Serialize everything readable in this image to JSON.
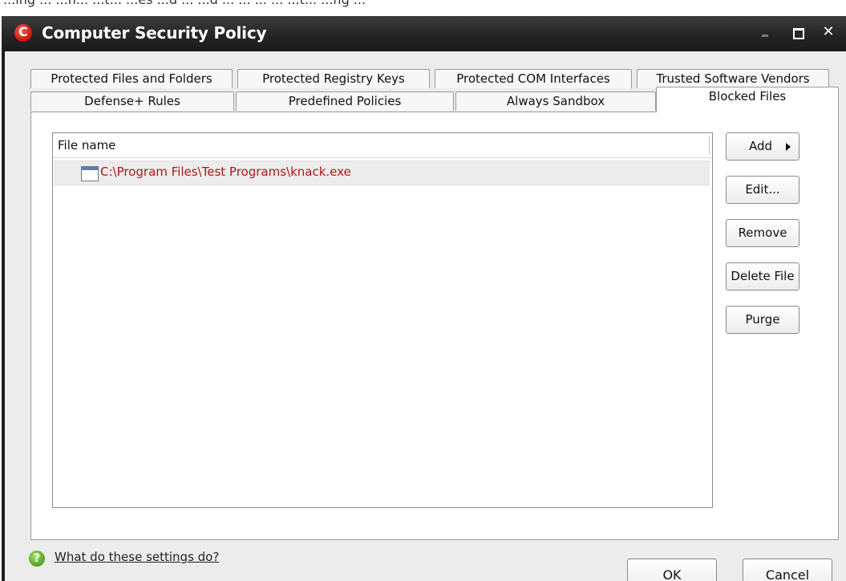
{
  "window": {
    "title": "Computer Security Policy",
    "bg_caption": "...ing ... ...n... ...t... ...es ...d ... ...d ... ... ... ... ...t... ...ng ..."
  },
  "tabs_row1": [
    {
      "label": "Protected Files and Folders"
    },
    {
      "label": "Protected Registry Keys"
    },
    {
      "label": "Protected COM Interfaces"
    },
    {
      "label": "Trusted Software Vendors"
    }
  ],
  "tabs_row2": [
    {
      "label": "Defense+ Rules"
    },
    {
      "label": "Predefined Policies"
    },
    {
      "label": "Always Sandbox"
    },
    {
      "label": "Blocked Files",
      "active": true
    }
  ],
  "file_list": {
    "header": "File name",
    "rows": [
      {
        "path": "C:\\Program Files\\Test Programs\\knack.exe"
      }
    ]
  },
  "side_buttons": {
    "add": "Add",
    "edit": "Edit...",
    "remove": "Remove",
    "delete_file": "Delete File",
    "purge": "Purge"
  },
  "footer": {
    "help_link": "What do these settings do?",
    "ok": "OK",
    "cancel": "Cancel"
  },
  "colors": {
    "titlebar": "#2b2b2b",
    "blocked_path": "#b01818",
    "logo": "#d81e10",
    "help_icon": "#5aa82a"
  },
  "icons": [
    "comodo-logo-icon",
    "minimize-icon",
    "maximize-icon",
    "close-icon",
    "application-window-icon",
    "submenu-arrow-icon",
    "help-icon",
    "resize-grip-icon"
  ]
}
